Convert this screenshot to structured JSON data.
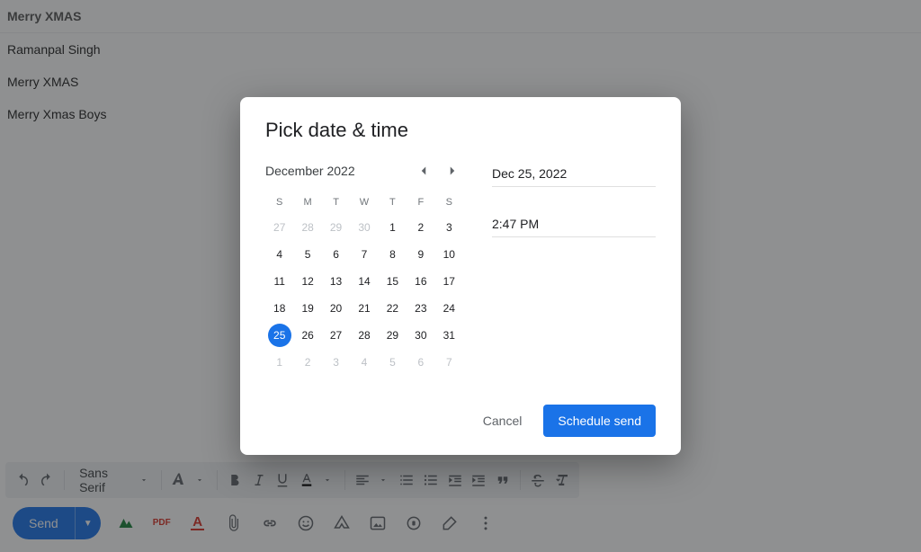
{
  "compose": {
    "lines": [
      {
        "text": "Merry XMAS",
        "bold": true
      },
      {
        "text": "Ramanpal Singh",
        "bold": false
      },
      {
        "text": "Merry XMAS",
        "bold": false
      },
      {
        "text": "Merry Xmas Boys",
        "bold": false
      }
    ],
    "font_label": "Sans Serif",
    "send_label": "Send",
    "pdf_label": "PDF"
  },
  "dialog": {
    "title": "Pick date & time",
    "month_label": "December 2022",
    "dow": [
      "S",
      "M",
      "T",
      "W",
      "T",
      "F",
      "S"
    ],
    "days": [
      {
        "n": 27,
        "off": true
      },
      {
        "n": 28,
        "off": true
      },
      {
        "n": 29,
        "off": true
      },
      {
        "n": 30,
        "off": true
      },
      {
        "n": 1
      },
      {
        "n": 2
      },
      {
        "n": 3
      },
      {
        "n": 4
      },
      {
        "n": 5
      },
      {
        "n": 6
      },
      {
        "n": 7
      },
      {
        "n": 8
      },
      {
        "n": 9
      },
      {
        "n": 10
      },
      {
        "n": 11
      },
      {
        "n": 12
      },
      {
        "n": 13
      },
      {
        "n": 14
      },
      {
        "n": 15
      },
      {
        "n": 16
      },
      {
        "n": 17
      },
      {
        "n": 18
      },
      {
        "n": 19
      },
      {
        "n": 20
      },
      {
        "n": 21
      },
      {
        "n": 22
      },
      {
        "n": 23
      },
      {
        "n": 24
      },
      {
        "n": 25,
        "sel": true
      },
      {
        "n": 26
      },
      {
        "n": 27
      },
      {
        "n": 28
      },
      {
        "n": 29
      },
      {
        "n": 30
      },
      {
        "n": 31
      },
      {
        "n": 1,
        "off": true
      },
      {
        "n": 2,
        "off": true
      },
      {
        "n": 3,
        "off": true
      },
      {
        "n": 4,
        "off": true
      },
      {
        "n": 5,
        "off": true
      },
      {
        "n": 6,
        "off": true
      },
      {
        "n": 7,
        "off": true
      }
    ],
    "date_value": "Dec 25, 2022",
    "time_value": "2:47 PM",
    "cancel_label": "Cancel",
    "schedule_label": "Schedule send"
  }
}
